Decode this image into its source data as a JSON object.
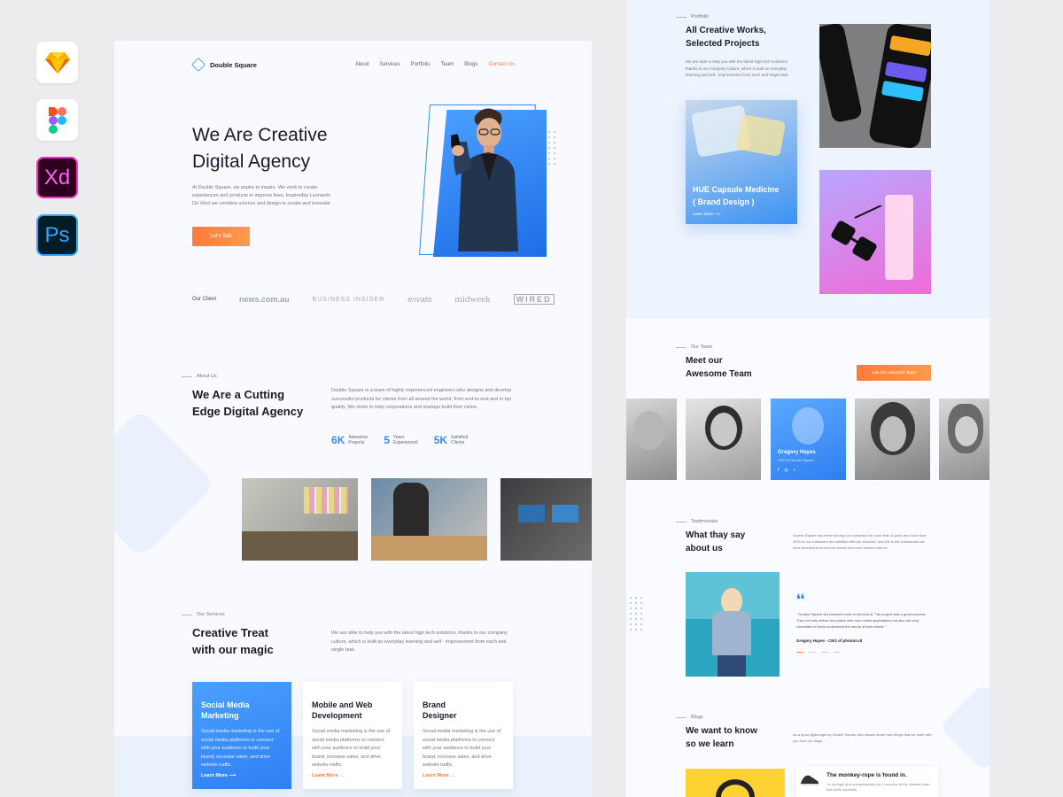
{
  "left": {
    "nav": {
      "brand": "Double Square",
      "links": [
        "About",
        "Services",
        "Portfolio",
        "Team",
        "Blogs",
        "Contact Us"
      ]
    },
    "hero": {
      "title_line1": "We Are Creative",
      "title_line2": "Digital Agency",
      "text": "At Double Square, we aspire to inspire. We work to create experiences and products to improve lives. Inspiredby Leonardo Da Vinci we combine science and design to create and innovate",
      "cta": "Let's Talk"
    },
    "clients": {
      "label": "Our Client",
      "logos": [
        "news.com.au",
        "BUSINESS INSIDER",
        "envato",
        "midweek",
        "WIRED"
      ]
    },
    "about": {
      "tag": "About Us",
      "title_line1": "We Are a Cutting",
      "title_line2": "Edge Digital Agency",
      "text": "Double Square is a team of highly experienced engineers who designs and develop successful products for clients from all around the world, from end-to-end and in top quality. We strive to help corporations and startups build their vision.",
      "stats": [
        {
          "num": "6K",
          "label1": "Awesome",
          "label2": "Projects"
        },
        {
          "num": "5",
          "label1": "Years",
          "label2": "Experienced"
        },
        {
          "num": "5K",
          "label1": "Satisfied",
          "label2": "Clients"
        }
      ]
    },
    "services": {
      "tag": "Our Services",
      "title_line1": "Creative Treat",
      "title_line2": "with our magic",
      "text": "We are able to help you with the latest high tech solutions, thanks to our company culture, which is built an everyday learning and self - improvement from each and single task.",
      "cards": [
        {
          "title1": "Social Media",
          "title2": "Marketing",
          "text": "Social media marketing is the use of social media platforms to connect with your audience to build your brand, increase sales, and drive website traffic.",
          "link": "Learn More"
        },
        {
          "title1": "Mobile and Web",
          "title2": "Development",
          "text": "Social media marketing is the use of social media platforms to connect with your audience to build your brand, increase sales, and drive website traffic.",
          "link": "Learn More"
        },
        {
          "title1": "Brand",
          "title2": "Designer",
          "text": "Social media marketing is the use of social media platforms to connect with your audience to build your brand, increase sales, and drive website traffic.",
          "link": "Learn More"
        }
      ]
    }
  },
  "right": {
    "portfolio": {
      "tag": "Portfolio",
      "title_line1": "All Creative Works,",
      "title_line2": "Selected Projects",
      "text": "We are able to help you with the latest high tech solutions, thanks to our company culture, which is built an everyday learning and self - improvement from each and single task.",
      "featured_title1": "HUE Capsule Medicine",
      "featured_title2": "( Brand Design )",
      "featured_link": "Learn More"
    },
    "team": {
      "tag": "Our Team",
      "title_line1": "Meet our",
      "title_line2": "Awesome Team",
      "cta": "Join Our Awesome Team",
      "highlight_name": "Gregory Hayes",
      "highlight_role": "CEO of Double Square"
    },
    "testimonials": {
      "tag": "Testimonials",
      "title_line1": "What thay say",
      "title_line2": "about us",
      "text": "Double Square has been serving our customers for more than 5 years and more than 3000 of our customers are satisfied with our services, and this is the testimonials we have received from several clients who have worked with us",
      "quote": "\" Double Square did excellent work on photoin.id. The project was a great success. They not only deliver innovative web and mobile applications but also are very committed to deep understand the needs of their clients. \"",
      "author": "Gregory Hayes - CEO of photoin.id"
    },
    "blogs": {
      "tag": "Blogs",
      "title_line1": "We want to know",
      "title_line2": "so we learn",
      "text": "As a good digital agency Double Square also always share new things that we learn with you from our blogs.",
      "post_title": "The monkey-rope is found in.",
      "post_text": "So strongly and metaphysically did I conceive of my situation then, that while earnestly"
    }
  }
}
